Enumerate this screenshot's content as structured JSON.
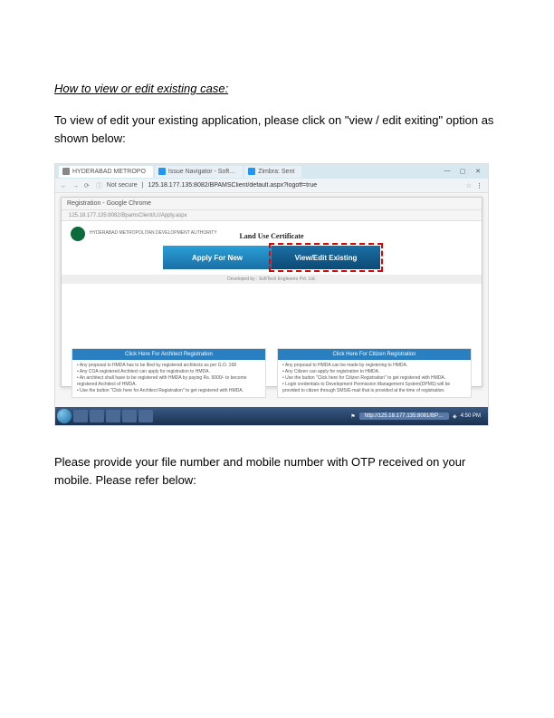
{
  "heading": "How to view or edit existing case:",
  "para1": "To view of edit your existing application, please click on \"view / edit exiting\" option as shown below:",
  "para2": "Please provide your file number and mobile number with OTP received on your mobile. Please refer below:",
  "screenshot": {
    "tabs": [
      {
        "label": "HYDERABAD METROPO"
      },
      {
        "label": "Issue Navigator - Soft…"
      },
      {
        "label": "Zimbra: Sent"
      }
    ],
    "url_bar": {
      "security": "Not secure",
      "url": "125.18.177.135:8082/BPAMSClient/default.aspx?logoff=true"
    },
    "popup": {
      "title": "Registration - Google Chrome",
      "url": "125.18.177.135:8082/BpamsClient/LUApply.aspx",
      "hmda_org": "HYDERABAD METROPOLITAN DEVELOPMENT AUTHORITY",
      "cert_title": "Land Use Certificate",
      "apply_btn": "Apply For New",
      "view_btn": "View/Edit Existing",
      "dev_footer": "Developed by : SoftTech Engineers Pvt. Ltd."
    },
    "left_box": {
      "title": "Click Here For Architect Registration",
      "l1": "• Any proposal to HMDA has to be filed by registered architects as per G.O. 168",
      "l2": "• Any COA registered Architect can apply for registration to HMDA.",
      "l3": "• An architect shall have to be registered with HMDA by paying Rs. 5000/- to become registered Architect of HMDA.",
      "l4": "• Use the button \"Click here for Architect Registration\" to get registered with HMDA."
    },
    "right_box": {
      "title": "Click Here For Citizen Registration",
      "l1": "• Any proposal to HMDA can be made by registering to HMDA.",
      "l2": "• Any Citizen can apply for registration to HMDA.",
      "l3": "• Use the button \"Click here for Citizen Registration\" to get registered with HMDA.",
      "l4": "• Login credentials to Development Permission Management System(DPMS) will be provided to citizen through SMS/E-mail that is provided at the time of registration."
    },
    "taskbar": {
      "url_display": "http://125.18.177.135:8081/BP…",
      "time": "4:50 PM"
    }
  }
}
